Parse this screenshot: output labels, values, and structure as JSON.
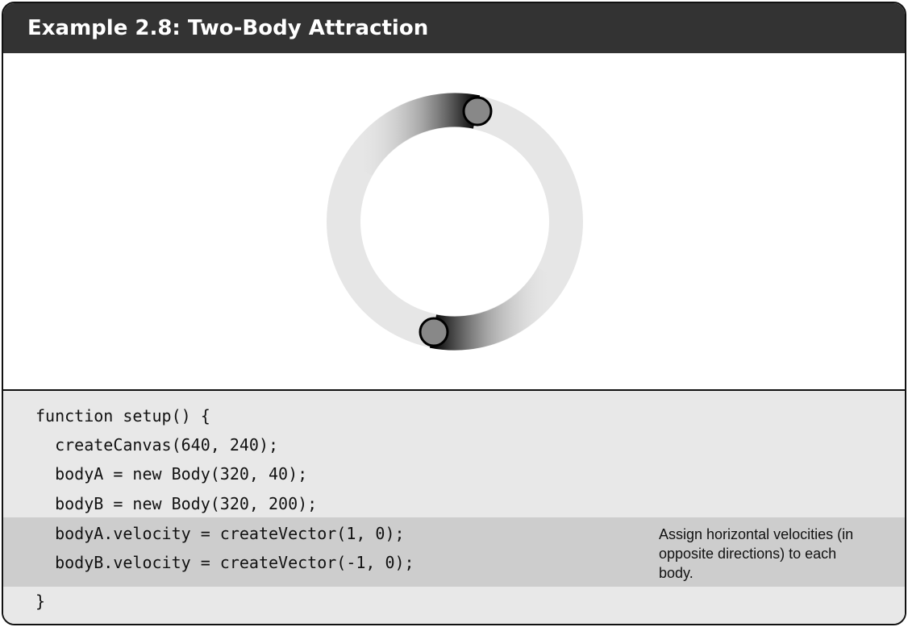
{
  "header": {
    "title": "Example 2.8: Two-Body Attraction"
  },
  "colors": {
    "header_bg": "#333333",
    "code_bg": "#e8e8e8",
    "highlight_bg": "#cdcdcd",
    "orbit_trail": "#e6e6e6",
    "body_fill": "#888888"
  },
  "canvas": {
    "bodies": [
      {
        "name": "bodyA"
      },
      {
        "name": "bodyB"
      }
    ]
  },
  "code": {
    "lines": [
      "function setup() {",
      "  createCanvas(640, 240);",
      "  bodyA = new Body(320, 40);",
      "  bodyB = new Body(320, 200);",
      "  bodyA.velocity = createVector(1, 0);",
      "  bodyB.velocity = createVector(-1, 0);",
      "}"
    ],
    "highlighted_lines": [
      4,
      5
    ],
    "annotation": "Assign horizontal velocities (in opposite directions) to each body."
  }
}
